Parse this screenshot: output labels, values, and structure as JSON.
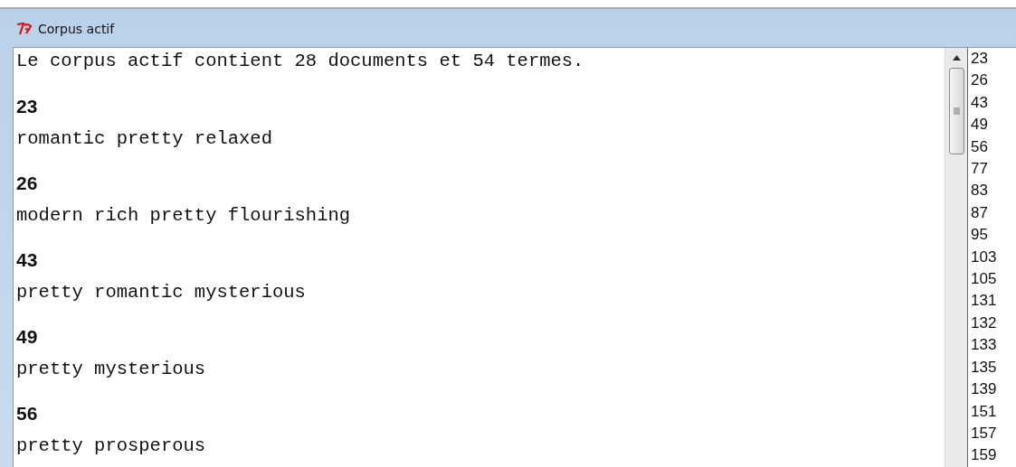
{
  "window": {
    "title": "Corpus actif"
  },
  "summary": "Le corpus actif contient 28 documents et 54 termes.",
  "documents": [
    {
      "id": "23",
      "terms": "romantic pretty relaxed"
    },
    {
      "id": "26",
      "terms": "modern rich pretty flourishing"
    },
    {
      "id": "43",
      "terms": "pretty romantic mysterious"
    },
    {
      "id": "49",
      "terms": "pretty mysterious"
    },
    {
      "id": "56",
      "terms": "pretty prosperous"
    }
  ],
  "id_list": [
    "23",
    "26",
    "43",
    "49",
    "56",
    "77",
    "83",
    "87",
    "95",
    "103",
    "105",
    "131",
    "132",
    "133",
    "135",
    "139",
    "151",
    "157",
    "159"
  ]
}
